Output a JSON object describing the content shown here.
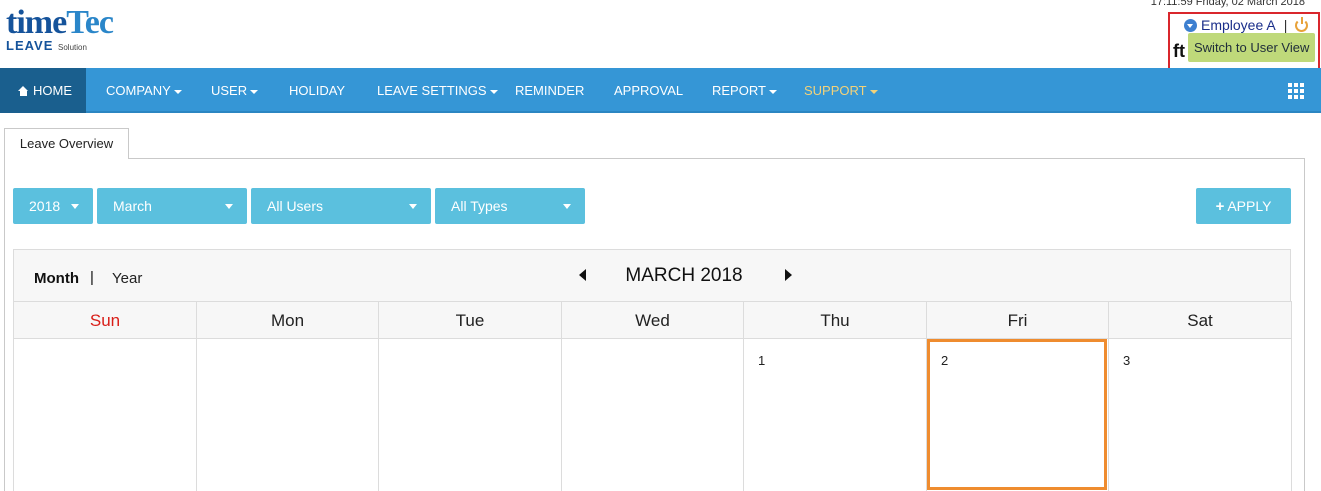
{
  "header": {
    "logo_time": "time",
    "logo_tec": "Tec",
    "logo_leave": "LEAVE",
    "logo_solution": "Solution",
    "datetime": "17:11:59 Friday, 02 March 2018",
    "user_name": "Employee A",
    "separator": "|",
    "tooltip": "Switch to User View",
    "partial_text": "ft"
  },
  "nav": {
    "items": [
      {
        "label": "HOME"
      },
      {
        "label": "COMPANY"
      },
      {
        "label": "USER"
      },
      {
        "label": "HOLIDAY"
      },
      {
        "label": "LEAVE SETTINGS"
      },
      {
        "label": "REMINDER"
      },
      {
        "label": "APPROVAL"
      },
      {
        "label": "REPORT"
      },
      {
        "label": "SUPPORT"
      }
    ],
    "support_color": "#f2d27a",
    "bar_color": "#3596d6"
  },
  "tabs": {
    "active": "Leave Overview"
  },
  "filters": {
    "year": "2018",
    "month": "March",
    "users": "All Users",
    "types": "All Types",
    "apply": "APPLY",
    "button_color": "#5bc0de"
  },
  "calendar": {
    "view_month": "Month",
    "view_sep": "|",
    "view_year": "Year",
    "title": "MARCH 2018",
    "weekdays": [
      "Sun",
      "Mon",
      "Tue",
      "Wed",
      "Thu",
      "Fri",
      "Sat"
    ],
    "days": {
      "thu": "1",
      "fri": "2",
      "sat": "3"
    },
    "today_color": "#ef8c2f",
    "sunday_color": "#d91e18"
  }
}
